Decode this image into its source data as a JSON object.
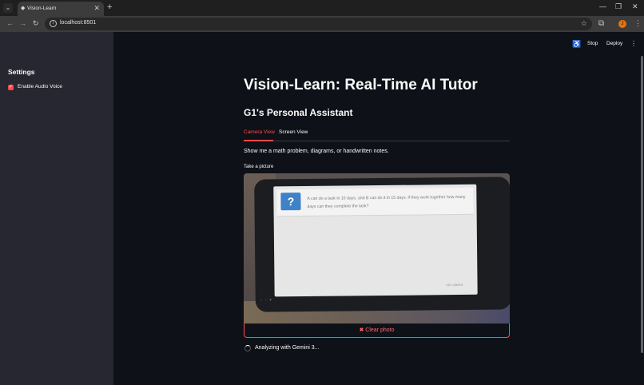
{
  "browser": {
    "tab_title": "Vision-Learn",
    "tab_close": "✕",
    "new_tab": "+",
    "url": "localhost:8501",
    "profile_initial": "J"
  },
  "sidebar": {
    "title": "Settings",
    "checkbox_label": "Enable Audio Voice",
    "checkbox_checked": true
  },
  "header": {
    "stop_label": "Stop",
    "deploy_label": "Deploy"
  },
  "main": {
    "title": "Vision-Learn: Real-Time AI Tutor",
    "subtitle": "G1's Personal Assistant",
    "tabs": [
      {
        "label": "Camera View",
        "active": true
      },
      {
        "label": "Screen View",
        "active": false
      }
    ],
    "prompt": "Show me a math problem, diagrams, or handwritten notes.",
    "camera_label": "Take a picture",
    "question_icon": "?",
    "question_text": "A can do a task in 10 days, and B can do it in 15 days. If they work together how many days can they complete the task?",
    "screen_tag": "KEY USER'S",
    "clear_button": "Clear photo",
    "status_text": "Analyzing with Gemini 3..."
  },
  "colors": {
    "accent": "#ff4b4b",
    "background": "#0e1117",
    "sidebar": "#262730"
  }
}
